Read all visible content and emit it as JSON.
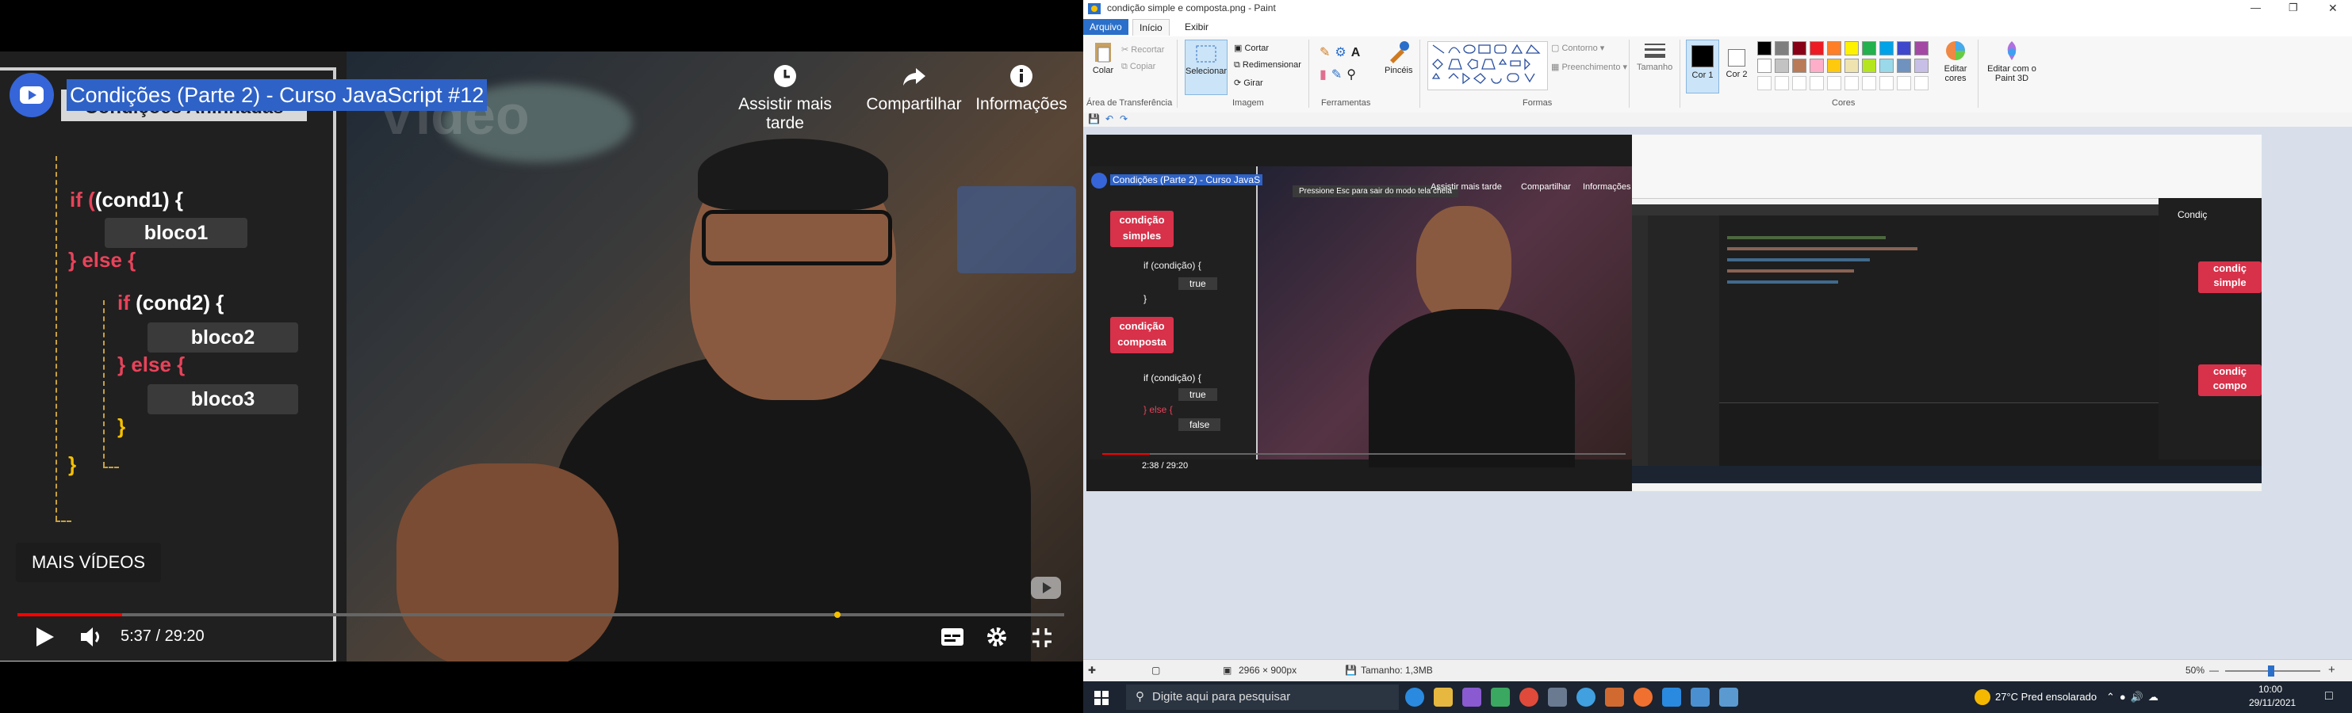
{
  "youtube": {
    "title": "Condições (Parte 2) - Curso JavaScript #12",
    "subtitle_chip": "Condições Aninhadas",
    "watermark": "Vídeo",
    "actions": {
      "watch_later": "Assistir mais tarde",
      "share": "Compartilhar",
      "info": "Informações"
    },
    "code": {
      "if_kw": "if",
      "cond1": "(cond1)",
      "brace": "{",
      "bloco1": "bloco1",
      "else_kw": "} else {",
      "cond2": "(cond2)",
      "bloco2": "bloco2",
      "else2": "} else {",
      "bloco3": "bloco3",
      "close1": "}",
      "close2": "}"
    },
    "more_videos": "MAIS VÍDEOS",
    "time": "5:37 / 29:20",
    "progress": 0.1,
    "chapter_marks": [
      0.78
    ]
  },
  "paint": {
    "window_title": "condição simple e composta.png - Paint",
    "tabs": [
      "Arquivo",
      "Início",
      "Exibir"
    ],
    "clipboard": {
      "paste": "Colar",
      "cut": "Recortar",
      "copy": "Copiar",
      "label": "Área de Transferência"
    },
    "image": {
      "select": "Selecionar",
      "crop": "Cortar",
      "resize": "Redimensionar",
      "rotate": "Girar",
      "label": "Imagem"
    },
    "tools_label": "Ferramentas",
    "brushes": "Pincéis",
    "shapes": {
      "outline": "Contorno",
      "fill": "Preenchimento",
      "label": "Formas"
    },
    "size": "Tamanho",
    "color1": "Cor 1",
    "color2": "Cor 2",
    "colors_label": "Cores",
    "edit_colors": "Editar cores",
    "paint3d": "Editar com o Paint 3D",
    "palette": [
      "#000000",
      "#7f7f7f",
      "#880015",
      "#ed1c24",
      "#ff7f27",
      "#fff200",
      "#22b14c",
      "#00a2e8",
      "#3f48cc",
      "#a349a4",
      "#ffffff",
      "#c3c3c3",
      "#b97a57",
      "#ffaec9",
      "#ffc90e",
      "#efe4b0",
      "#b5e61d",
      "#99d9ea",
      "#7092be",
      "#c8bfe7"
    ],
    "status": {
      "dimensions": "2966 × 900px",
      "size": "Tamanho: 1,3MB",
      "zoom": "50%"
    },
    "nested": {
      "title": "Condições (Parte 2) - Curso JavaS",
      "watch_later": "Assistir mais tarde",
      "share": "Compartilhar",
      "info": "Informações",
      "esc_hint": "Pressione  Esc  para sair do modo tela cheia",
      "cond_simple": "condição simples",
      "cond_comp": "condição composta",
      "if_cond": "if (condição) {",
      "true1": "true",
      "close": "}",
      "if_cond2": "if (condição) {",
      "true2": "true",
      "else": "} else {",
      "false": "false",
      "time": "2:38 / 29:20",
      "right_title": "Condiç",
      "right_c1": "condiç simple",
      "right_c2": "condiç compo"
    }
  },
  "taskbar": {
    "search": "Digite aqui para pesquisar",
    "weather": "27°C  Pred ensolarado",
    "clock_time": "10:00",
    "clock_date": "29/11/2021"
  }
}
